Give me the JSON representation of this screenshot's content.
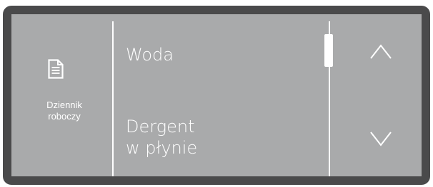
{
  "menu": {
    "label_line1": "Dziennik",
    "label_line2": "roboczy",
    "icon": "document-icon"
  },
  "list": {
    "items": [
      {
        "line1": "Woda",
        "line2": ""
      },
      {
        "line1": "Dergent",
        "line2": "w płynie"
      }
    ]
  },
  "controls": {
    "scroll_up_icon": "chevron-up-icon",
    "scroll_down_icon": "chevron-down-icon"
  },
  "colors": {
    "screen": "#a9aaab",
    "bezel": "#4a4a4b",
    "foreground": "#ffffff"
  }
}
